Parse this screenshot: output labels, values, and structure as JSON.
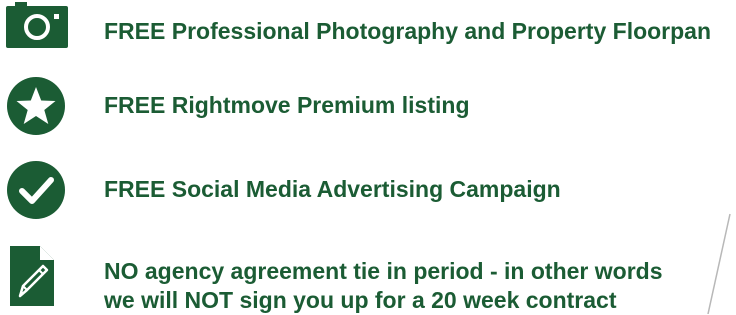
{
  "colors": {
    "brand": "#1b5c34",
    "icon_fg": "#ffffff"
  },
  "features": [
    {
      "icon": "camera-icon",
      "text": "FREE Professional Photography and Property Floorpan"
    },
    {
      "icon": "star-badge-icon",
      "text": "FREE Rightmove Premium listing"
    },
    {
      "icon": "checkmark-badge-icon",
      "text": "FREE Social Media Advertising Campaign"
    },
    {
      "icon": "document-pen-icon",
      "text_lines": [
        "NO agency agreement tie in period - in other words",
        "we will NOT sign you up for a 20 week contract"
      ]
    }
  ]
}
